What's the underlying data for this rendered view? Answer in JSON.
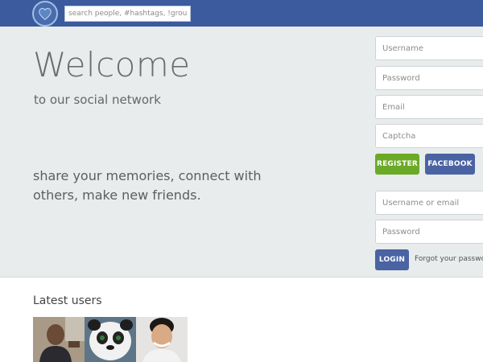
{
  "header": {
    "logo_icon": "heart-icon",
    "search": {
      "placeholder": "search people, #hashtags, !groups"
    }
  },
  "hero": {
    "title": "Welcome",
    "subtitle": "to our social network",
    "tagline": "share your memories, connect with others, make new friends."
  },
  "register": {
    "username_placeholder": "Username",
    "password_placeholder": "Password",
    "email_placeholder": "Email",
    "captcha_placeholder": "Captcha",
    "register_label": "REGISTER",
    "facebook_label": "FACEBOOK"
  },
  "login": {
    "username_placeholder": "Username or email",
    "password_placeholder": "Password",
    "login_label": "LOGIN",
    "forgot_label": "Forgot your password?"
  },
  "latest_users": {
    "title": "Latest users"
  },
  "colors": {
    "topbar": "#3b5b9e",
    "hero_bg": "#e8ecec",
    "register_green": "#6aaa27",
    "facebook_blue": "#4a63a3"
  }
}
